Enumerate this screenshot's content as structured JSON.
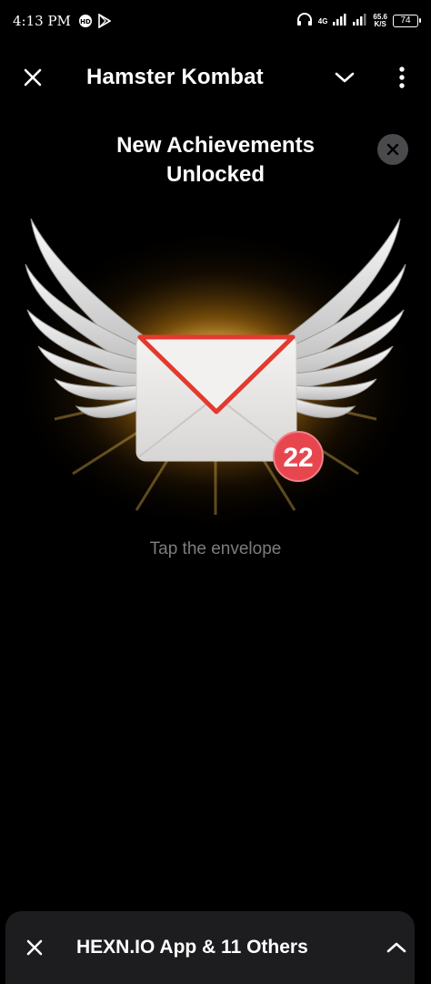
{
  "status_bar": {
    "time": "4:13 PM",
    "network": "4G",
    "speed_value": "65.6",
    "speed_unit": "K/S",
    "battery": "74",
    "icons": [
      "hd-icon",
      "play-store-icon",
      "headphones-icon",
      "signal-icon",
      "wifi-icon",
      "battery-icon"
    ]
  },
  "header": {
    "title": "Hamster Kombat",
    "icons": [
      "close-icon",
      "chevron-down-icon",
      "more-vertical-icon"
    ]
  },
  "achievement": {
    "title_line1": "New Achievements",
    "title_line2": "Unlocked",
    "badge_count": "22",
    "hint": "Tap the envelope"
  },
  "bottom_bar": {
    "label": "HEXN.IO App & 11 Others",
    "icons": [
      "close-icon",
      "chevron-up-icon"
    ]
  },
  "colors": {
    "background": "#000000",
    "badge": "#e8464f",
    "envelope_flap_border": "#e23a2f",
    "glow": "#f7b733",
    "hint_text": "#7c7c7c",
    "bottom_bar": "#1d1d1f"
  }
}
